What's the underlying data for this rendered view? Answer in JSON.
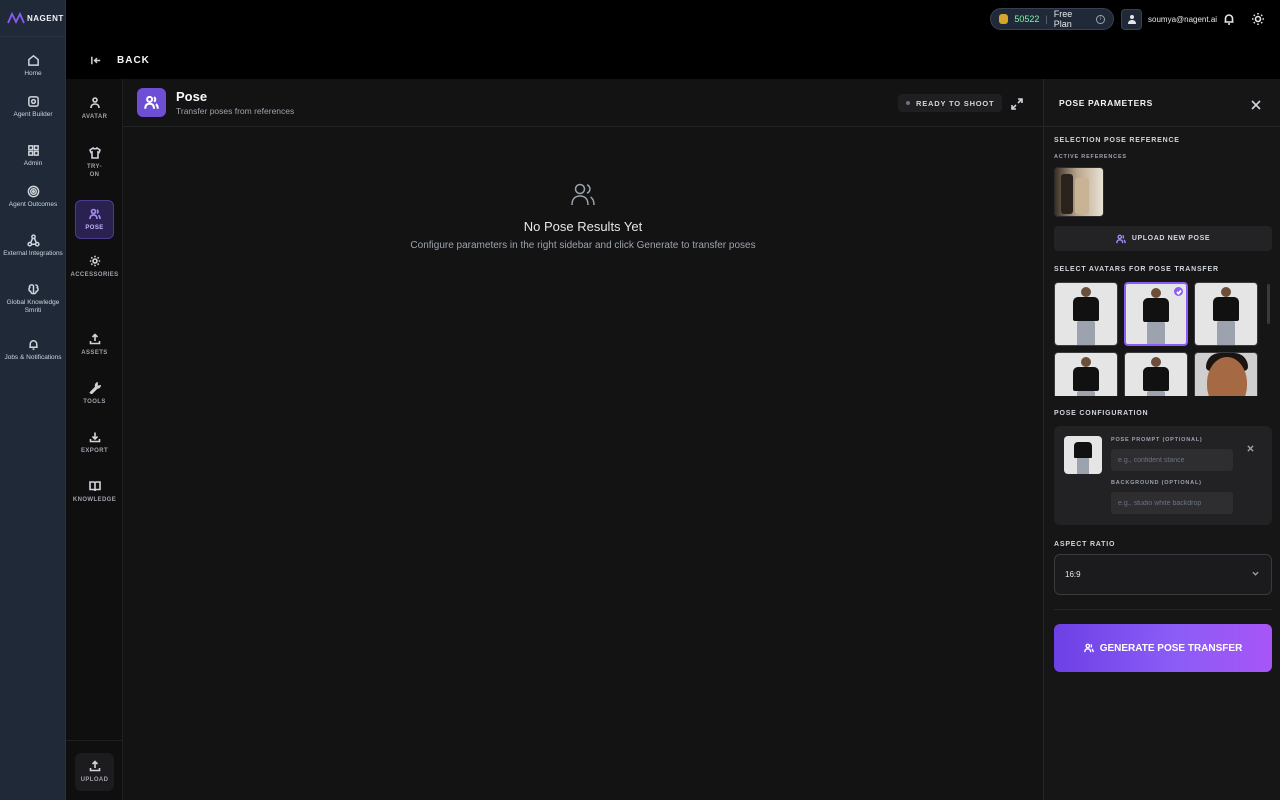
{
  "app": {
    "brand": "NAGENT"
  },
  "left_nav": [
    {
      "label": "Home",
      "icon": "home-icon"
    },
    {
      "label": "Agent Builder",
      "icon": "cube-icon"
    },
    {
      "label": "Admin",
      "icon": "grid-icon"
    },
    {
      "label": "Agent Outcomes",
      "icon": "target-icon"
    },
    {
      "label": "External Integrations",
      "icon": "share-icon"
    },
    {
      "label": "Global Knowledge Smriti",
      "icon": "brain-icon"
    },
    {
      "label": "Jobs & Notifications",
      "icon": "bell-icon"
    }
  ],
  "tool_nav": [
    {
      "label": "AVATAR",
      "icon": "person-icon"
    },
    {
      "label": "TRY-ON",
      "icon": "shirt-icon"
    },
    {
      "label": "POSE",
      "icon": "users-icon",
      "active": true
    },
    {
      "label": "ACCESSORIES",
      "icon": "gear-icon"
    },
    {
      "label": "ASSETS",
      "icon": "upload-icon"
    },
    {
      "label": "TOOLS",
      "icon": "wrench-icon"
    },
    {
      "label": "EXPORT",
      "icon": "download-icon"
    },
    {
      "label": "KNOWLEDGE",
      "icon": "book-icon"
    },
    {
      "label": "UPLOAD",
      "icon": "upload-icon"
    }
  ],
  "topbar": {
    "credits": "50522",
    "plan": "Free Plan",
    "user_email": "soumya@nagent.ai",
    "back_label": "BACK"
  },
  "main": {
    "title": "Pose",
    "subtitle": "Transfer poses from references",
    "status": "READY TO SHOOT",
    "empty_title": "No Pose Results Yet",
    "empty_subtitle": "Configure parameters in the right sidebar and click Generate to transfer poses"
  },
  "panel": {
    "title": "POSE PARAMETERS",
    "selection_label": "SELECTION POSE REFERENCE",
    "active_refs_label": "ACTIVE REFERENCES",
    "upload_label": "UPLOAD NEW POSE",
    "avatars_label": "SELECT AVATARS FOR POSE TRANSFER",
    "avatars_selected_index": 1,
    "config_label": "POSE CONFIGURATION",
    "prompt_label": "POSE PROMPT (OPTIONAL)",
    "prompt_placeholder": "e.g., confident stance",
    "background_label": "BACKGROUND (OPTIONAL)",
    "background_placeholder": "e.g., studio white backdrop",
    "aspect_label": "ASPECT RATIO",
    "aspect_value": "16:9",
    "generate_label": "GENERATE POSE TRANSFER"
  },
  "colors": {
    "accent": "#8b5cf6",
    "accent_dark": "#6d40e6",
    "credits": "#86efac"
  }
}
